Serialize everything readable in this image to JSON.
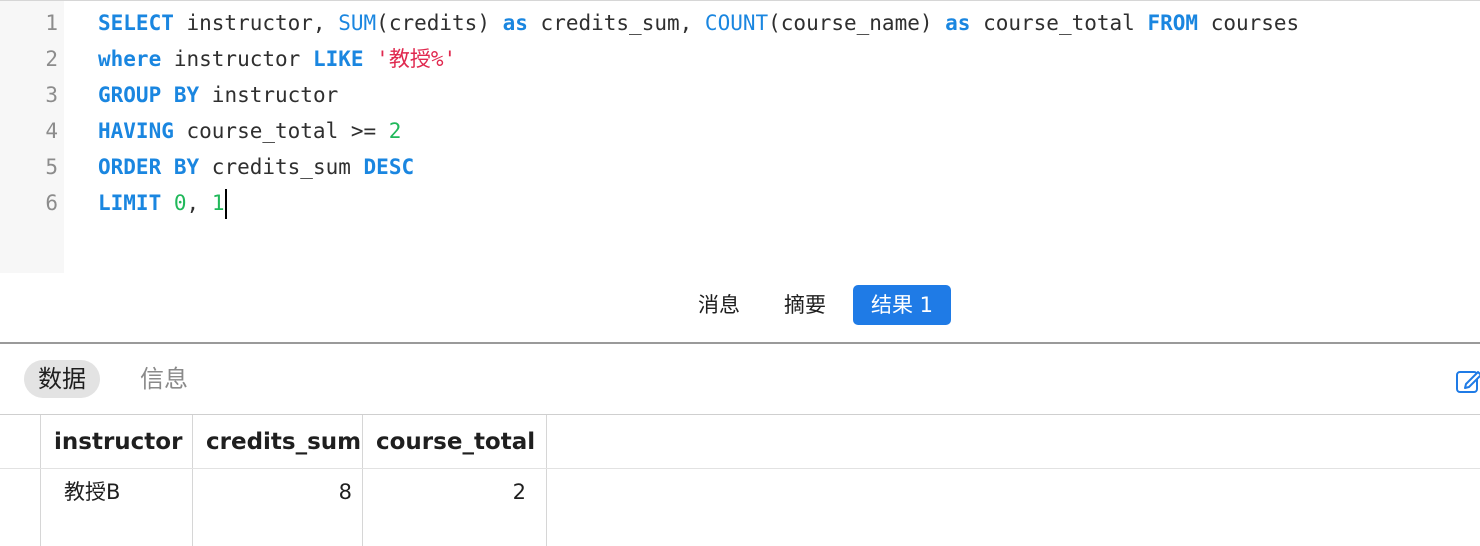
{
  "editor": {
    "line_numbers": [
      "1",
      "2",
      "3",
      "4",
      "5",
      "6"
    ],
    "lines": [
      [
        {
          "t": "SELECT",
          "c": "kw"
        },
        {
          "t": " instructor, ",
          "c": ""
        },
        {
          "t": "SUM",
          "c": "fn"
        },
        {
          "t": "(credits) ",
          "c": ""
        },
        {
          "t": "as",
          "c": "kw"
        },
        {
          "t": " credits_sum, ",
          "c": ""
        },
        {
          "t": "COUNT",
          "c": "fn"
        },
        {
          "t": "(course_name) ",
          "c": ""
        },
        {
          "t": "as",
          "c": "kw"
        },
        {
          "t": " course_total ",
          "c": ""
        },
        {
          "t": "FROM",
          "c": "kw"
        },
        {
          "t": " courses",
          "c": ""
        }
      ],
      [
        {
          "t": "where",
          "c": "kw"
        },
        {
          "t": " instructor ",
          "c": ""
        },
        {
          "t": "LIKE",
          "c": "kw"
        },
        {
          "t": " ",
          "c": ""
        },
        {
          "t": "'教授%'",
          "c": "str"
        }
      ],
      [
        {
          "t": "GROUP BY",
          "c": "kw"
        },
        {
          "t": " instructor",
          "c": ""
        }
      ],
      [
        {
          "t": "HAVING",
          "c": "kw"
        },
        {
          "t": " course_total >= ",
          "c": ""
        },
        {
          "t": "2",
          "c": "num"
        }
      ],
      [
        {
          "t": "ORDER BY",
          "c": "kw"
        },
        {
          "t": " credits_sum ",
          "c": ""
        },
        {
          "t": "DESC",
          "c": "kw"
        }
      ],
      [
        {
          "t": "LIMIT",
          "c": "kw"
        },
        {
          "t": " ",
          "c": ""
        },
        {
          "t": "0",
          "c": "num"
        },
        {
          "t": ", ",
          "c": ""
        },
        {
          "t": "1",
          "c": "num"
        }
      ]
    ]
  },
  "result_tabs": {
    "messages": "消息",
    "summary": "摘要",
    "result1": "结果 1"
  },
  "sub_tabs": {
    "data": "数据",
    "info": "信息"
  },
  "icons": {
    "edit": "pencil-edit-icon"
  },
  "table": {
    "columns": [
      "instructor",
      "credits_sum",
      "course_total"
    ],
    "rows": [
      [
        "教授B",
        "8",
        "2"
      ]
    ]
  },
  "colors": {
    "keyword": "#1a86e0",
    "string": "#e0294f",
    "number": "#20b85a",
    "active_tab": "#1f7be6"
  }
}
